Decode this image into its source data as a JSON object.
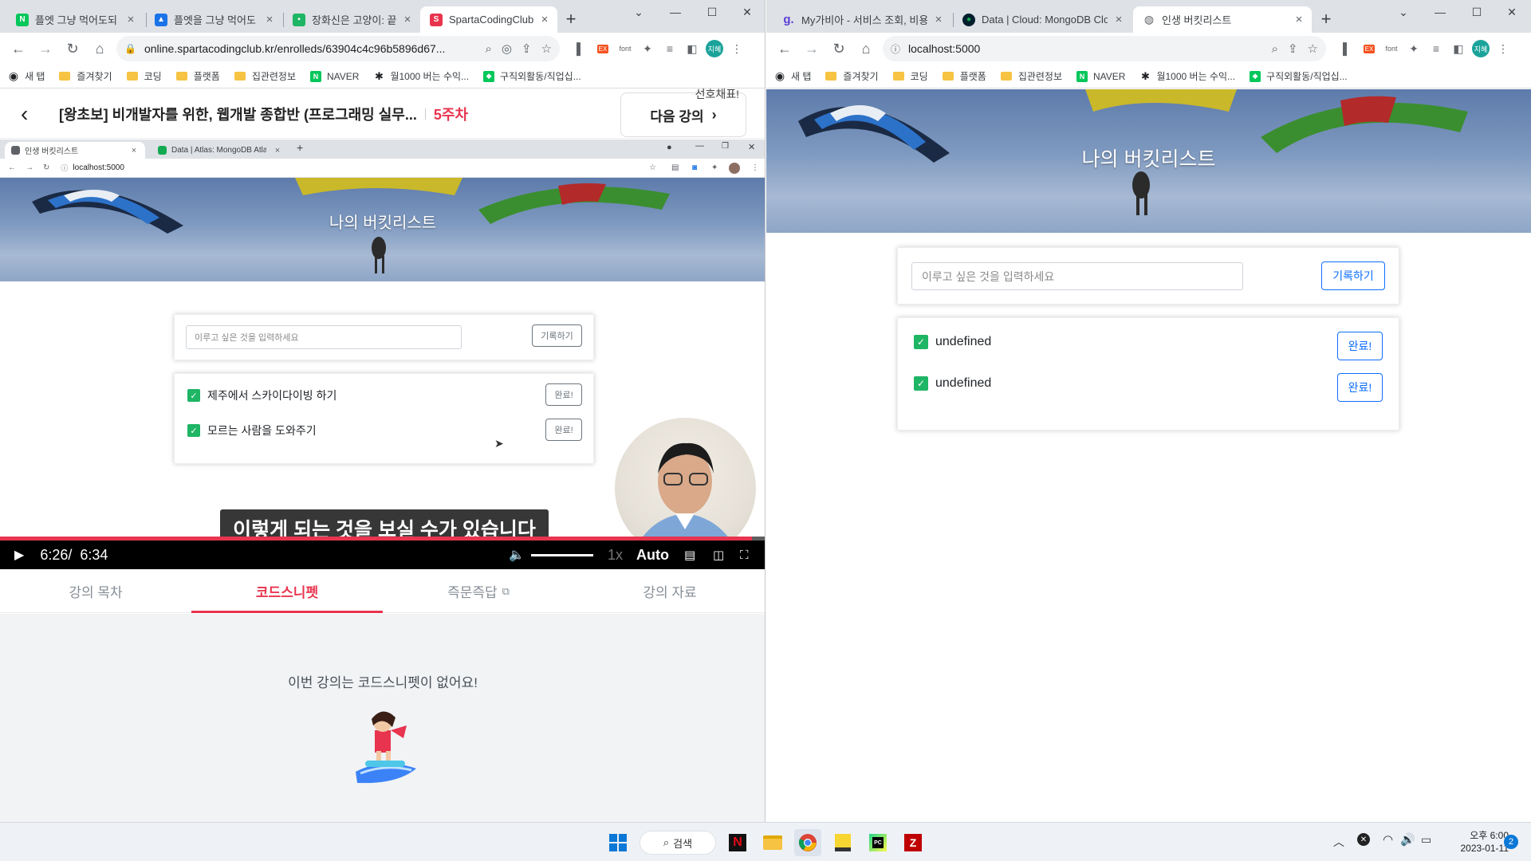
{
  "left_window": {
    "tabs": [
      {
        "label": "플엣 그냥 먹어도되",
        "icon": "naver-icon",
        "color": "#03c75a"
      },
      {
        "label": "플엣을 그냥 먹어도",
        "icon": "graduation-icon",
        "color": "#1a73e8"
      },
      {
        "label": "장화신은 고양이: 끝",
        "icon": "green-square-icon",
        "color": "#1eb565"
      },
      {
        "label": "SpartaCodingClub",
        "icon": "sparta-icon",
        "color": "#e8344e"
      }
    ],
    "url": "online.spartacodingclub.kr/enrolleds/63904c4c96b5896d67...",
    "bookmarks": [
      "새 탭",
      "즐겨찾기",
      "코딩",
      "플랫폼",
      "집관련정보",
      "NAVER",
      "월1000 버는 수익...",
      "구직외활동/직업십..."
    ],
    "course": {
      "title": "[왕초보] 비개발자를 위한, 웹개발 종합반 (프로그래밍 실무...",
      "week": "5주차",
      "next_label": "다음 강의",
      "overflow_text": "선호채표!"
    },
    "video": {
      "inner_tabs": [
        "인생 버킷리스트",
        "Data | Atlas: MongoDB Atlas"
      ],
      "inner_url": "localhost:5000",
      "hero_title": "나의 버킷리스트",
      "input_placeholder": "이루고 싶은 것을 입력하세요",
      "record_label": "기록하기",
      "items": [
        {
          "text": "제주에서 스카이다이빙 하기",
          "done": "완료!"
        },
        {
          "text": "모르는 사람을 도와주기",
          "done": "완료!"
        }
      ],
      "subtitle": "이렇게 되는 것을 보실 수가 있습니다",
      "current_time": "6:26/",
      "duration": "6:34",
      "progress": 0.982,
      "volume": 1.0,
      "speed": "1x",
      "quality": "Auto"
    },
    "lesson_tabs": [
      {
        "label": "강의 목차",
        "active": false
      },
      {
        "label": "코드스니펫",
        "active": true
      },
      {
        "label": "즉문즉답",
        "active": false
      },
      {
        "label": "강의 자료",
        "active": false
      }
    ],
    "snippet_empty": "이번 강의는 코드스니펫이 없어요!"
  },
  "right_window": {
    "tabs": [
      {
        "label": "My가비아 - 서비스 조회, 비용",
        "icon": "gabia-icon",
        "color": "#5b3fd6"
      },
      {
        "label": "Data | Cloud: MongoDB Cloud",
        "icon": "mongodb-leaf-icon",
        "color": "#13aa52"
      },
      {
        "label": "인생 버킷리스트",
        "icon": "globe-icon",
        "color": "#5f6368"
      }
    ],
    "url": "localhost:5000",
    "bookmarks": [
      "새 탭",
      "즐겨찾기",
      "코딩",
      "플랫폼",
      "집관련정보",
      "NAVER",
      "월1000 버는 수익...",
      "구직외활동/직업십..."
    ],
    "hero_title": "나의 버킷리스트",
    "input_placeholder": "이루고 싶은 것을 입력하세요",
    "record_label": "기록하기",
    "items": [
      {
        "text": "undefined",
        "done": "완료!"
      },
      {
        "text": "undefined",
        "done": "완료!"
      }
    ]
  },
  "taskbar": {
    "search_label": "검색",
    "apps": [
      "windows-start-icon",
      "search-icon",
      "netflix-icon",
      "file-explorer-icon",
      "chrome-icon",
      "sticky-notes-icon",
      "pycharm-icon",
      "filezilla-icon"
    ],
    "time": "오후 6:00",
    "date": "2023-01-11",
    "notifications": "2"
  },
  "colors": {
    "accent_red": "#e8344e",
    "bootstrap_blue": "#0d6efd",
    "check_green": "#1eb565"
  }
}
